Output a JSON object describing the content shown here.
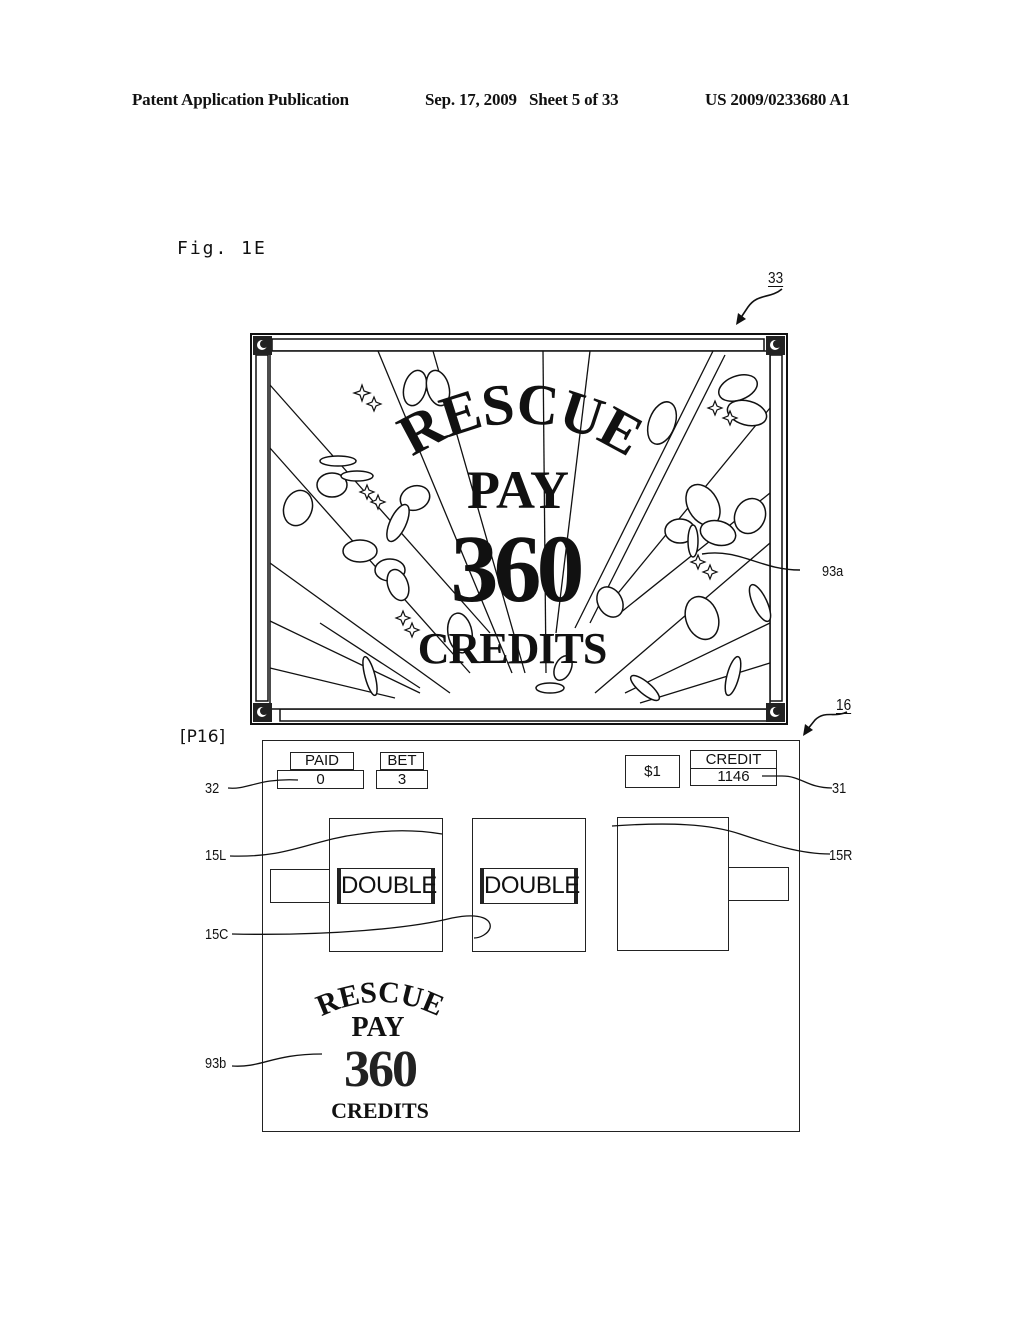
{
  "header": {
    "publication": "Patent Application Publication",
    "date_sheet": "Sep. 17, 2009   Sheet 5 of 33",
    "number": "US 2009/0233680 A1"
  },
  "figure": {
    "label": "Fig. 1E",
    "upper_display": {
      "ref": "33",
      "effect_ref": "93a",
      "title_line1": "RESCUE",
      "title_line2": "PAY",
      "amount": "360",
      "unit": "CREDITS",
      "icons": [
        "coin-icon",
        "sparkle-icon",
        "starburst-rays",
        "corner-ornament-icon"
      ]
    },
    "lower_display": {
      "state_label": "[P16]",
      "ref": "16",
      "paid": {
        "label": "PAID",
        "value": "0",
        "ref": "32"
      },
      "bet": {
        "label": "BET",
        "value": "3"
      },
      "denomination": "$1",
      "credit": {
        "label": "CREDIT",
        "value": "1146",
        "ref": "31"
      },
      "reels": {
        "left": {
          "ref": "15L",
          "symbol": "DOUBLE"
        },
        "center": {
          "ref": "15C",
          "symbol": "DOUBLE"
        },
        "right": {
          "ref": "15R",
          "symbol": ""
        }
      },
      "effect": {
        "ref": "93b",
        "title_line1": "RESCUE",
        "title_line2": "PAY",
        "amount": "360",
        "unit": "CREDITS"
      }
    }
  }
}
